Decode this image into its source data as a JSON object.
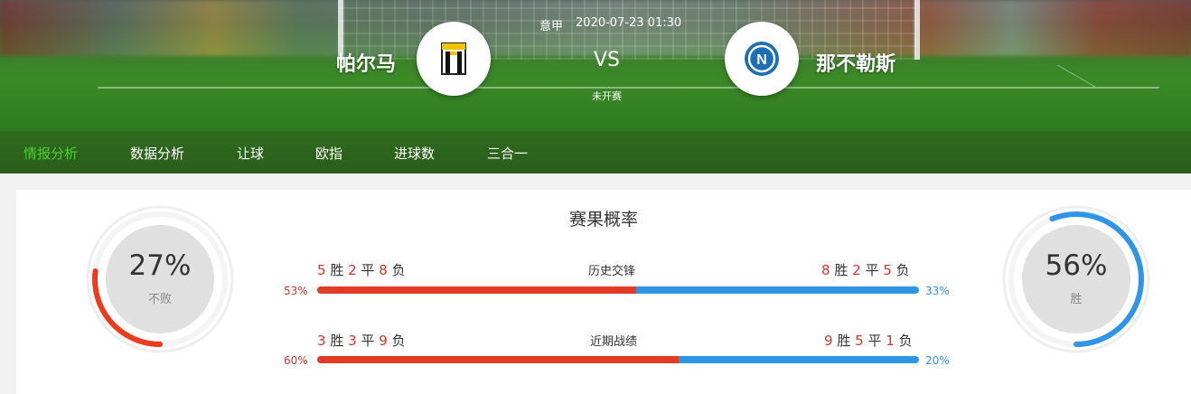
{
  "match": {
    "league": "意甲",
    "datetime": "2020-07-23 01:30",
    "vs": "VS",
    "status": "未开赛",
    "home": {
      "name": "帕尔马"
    },
    "away": {
      "name": "那不勒斯"
    }
  },
  "nav": {
    "items": [
      {
        "label": "情报分析",
        "active": true
      },
      {
        "label": "数据分析"
      },
      {
        "label": "让球"
      },
      {
        "label": "欧指"
      },
      {
        "label": "进球数"
      },
      {
        "label": "三合一"
      }
    ]
  },
  "panel": {
    "title": "赛果概率",
    "home_gauge": {
      "value": "27%",
      "label": "不败",
      "fraction": 0.27,
      "color": "#f03a1e"
    },
    "away_gauge": {
      "value": "56%",
      "label": "胜",
      "fraction": 0.56,
      "color": "#2f95e6"
    },
    "rows": [
      {
        "label": "历史交锋",
        "home": {
          "w": "5",
          "w_label": "胜",
          "d": "2",
          "d_label": "平",
          "l": "8",
          "l_label": "负"
        },
        "away": {
          "w": "8",
          "w_label": "胜",
          "d": "2",
          "d_label": "平",
          "l": "5",
          "l_label": "负"
        },
        "home_pct": "53%",
        "away_pct": "33%",
        "home_fraction": 0.53
      },
      {
        "label": "近期战绩",
        "home": {
          "w": "3",
          "w_label": "胜",
          "d": "3",
          "d_label": "平",
          "l": "9",
          "l_label": "负"
        },
        "away": {
          "w": "9",
          "w_label": "胜",
          "d": "5",
          "d_label": "平",
          "l": "1",
          "l_label": "负"
        },
        "home_pct": "60%",
        "away_pct": "20%",
        "home_fraction": 0.6
      }
    ]
  }
}
